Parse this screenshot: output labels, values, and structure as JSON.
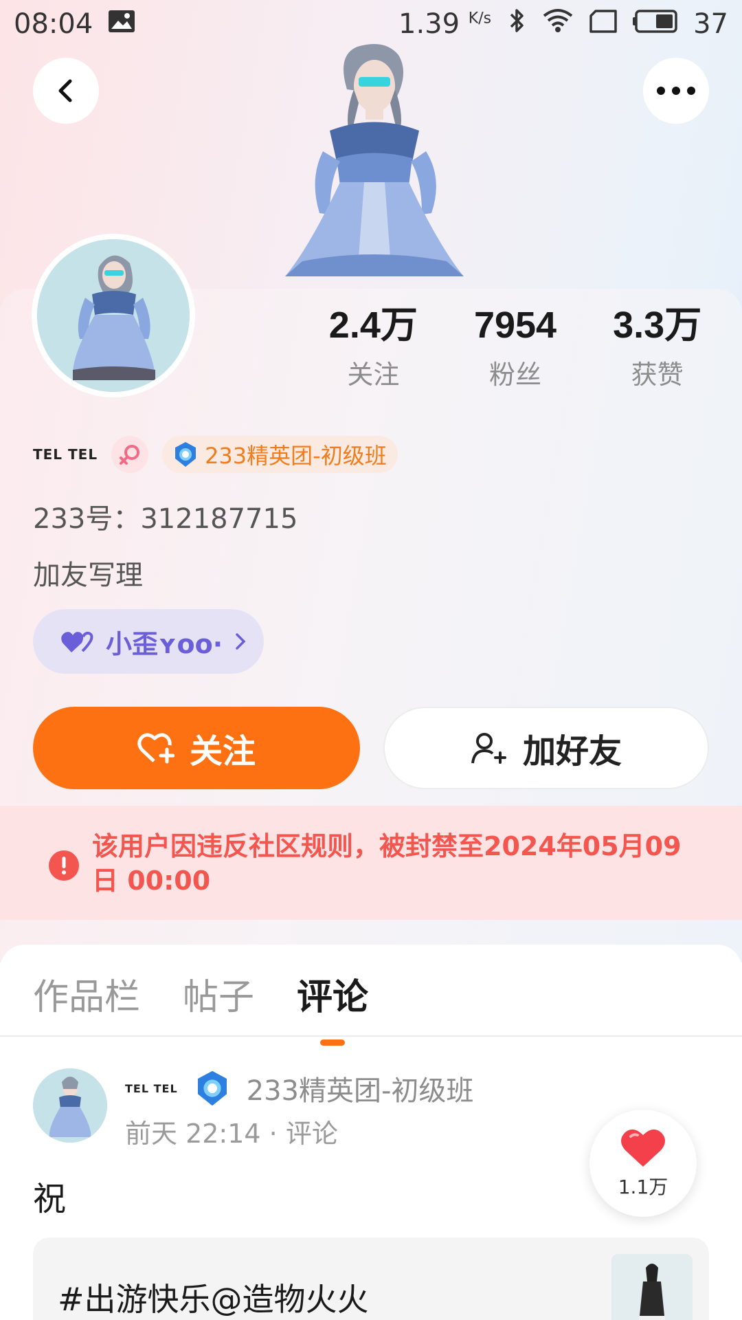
{
  "status_bar": {
    "time": "08:04",
    "net_speed": "1.39",
    "net_speed_unit": "K/s",
    "battery": "37"
  },
  "profile": {
    "nickname": "TEL TEL",
    "team_badge": "233精英团-初级班",
    "uid": "233号：312187715",
    "bio": "加友写理",
    "cp_name": "小歪ʏᴏᴏ·",
    "stats": [
      {
        "value": "2.4万",
        "label": "关注"
      },
      {
        "value": "7954",
        "label": "粉丝"
      },
      {
        "value": "3.3万",
        "label": "获赞"
      }
    ]
  },
  "actions": {
    "follow_label": "关注",
    "add_friend_label": "加好友"
  },
  "ban_notice": "该用户因违反社区规则，被封禁至2024年05月09日 00:00",
  "tabs": [
    {
      "label": "作品栏",
      "active": false
    },
    {
      "label": "帖子",
      "active": false
    },
    {
      "label": "评论",
      "active": true
    }
  ],
  "post": {
    "author": "TEL TEL",
    "team": "233精英团-初级班",
    "meta": "前天 22:14 · 评论",
    "body": "祝",
    "like_count": "1.1万",
    "quote": "#出游快乐@造物火火"
  },
  "colors": {
    "accent": "#fe7113",
    "ban_text": "#f2564f",
    "ban_bg": "#fde3e4",
    "cp_text": "#6a5fd9",
    "team_text": "#f07c1c"
  }
}
